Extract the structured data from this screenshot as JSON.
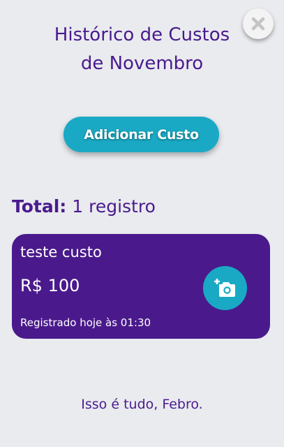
{
  "header": {
    "title_line1": "Histórico de Custos",
    "title_line2": "de Novembro",
    "close_icon": "close-icon"
  },
  "actions": {
    "add_label": "Adicionar Custo"
  },
  "summary": {
    "total_label": "Total:",
    "total_value": "1 registro"
  },
  "costs": [
    {
      "name": "teste custo",
      "value": "R$ 100",
      "registered": "Registrado hoje às 01:30",
      "action_icon": "add-photo-icon"
    }
  ],
  "footer": {
    "message": "Isso é tudo, Febro."
  },
  "colors": {
    "primary": "#4a1a8c",
    "accent": "#1aa9c4",
    "background": "#e9ebef"
  }
}
